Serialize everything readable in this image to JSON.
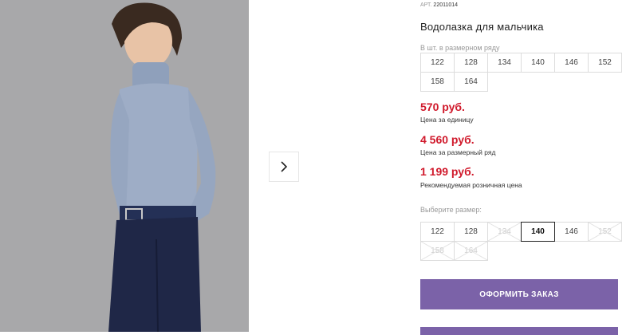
{
  "product": {
    "sku_label": "АРТ.",
    "sku_value": "22011014",
    "title": "Водолазка для мальчика"
  },
  "size_row": {
    "label": "В шт. в размерном ряду",
    "sizes": [
      "122",
      "128",
      "134",
      "140",
      "146",
      "152",
      "158",
      "164"
    ]
  },
  "prices": {
    "unit_price": "570 руб.",
    "unit_note": "Цена за единицу",
    "row_price": "4 560 руб.",
    "row_note": "Цена за размерный ряд",
    "retail_price": "1 199 руб.",
    "retail_note": "Рекомендуемая розничная цена"
  },
  "size_select": {
    "label": "Выберите размер:",
    "options": [
      {
        "value": "122",
        "state": "available"
      },
      {
        "value": "128",
        "state": "available"
      },
      {
        "value": "134",
        "state": "unavailable"
      },
      {
        "value": "140",
        "state": "selected"
      },
      {
        "value": "146",
        "state": "available"
      },
      {
        "value": "152",
        "state": "unavailable"
      },
      {
        "value": "158",
        "state": "unavailable"
      },
      {
        "value": "164",
        "state": "unavailable"
      }
    ]
  },
  "actions": {
    "order_label": "ОФОРМИТЬ ЗАКАЗ"
  },
  "colors": {
    "price_red": "#d0192b",
    "button_purple": "#7b62a8",
    "photo_bg": "#a8a8aa"
  },
  "icons": {
    "next": "chevron-right-icon"
  }
}
